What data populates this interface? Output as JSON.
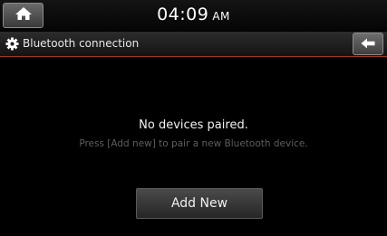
{
  "status_bar": {
    "time": "04:09",
    "ampm": "AM",
    "home_icon": "home-icon"
  },
  "title_bar": {
    "title": "Bluetooth connection",
    "title_icon": "gear-icon",
    "back_icon": "back-arrow-icon"
  },
  "main": {
    "message": "No devices paired.",
    "hint": "Press [Add new] to pair a new Bluetooth device.",
    "add_button_label": "Add New"
  },
  "colors": {
    "background": "#000000",
    "title_underline": "#a0381f",
    "hint_text": "#5e5e5e"
  }
}
